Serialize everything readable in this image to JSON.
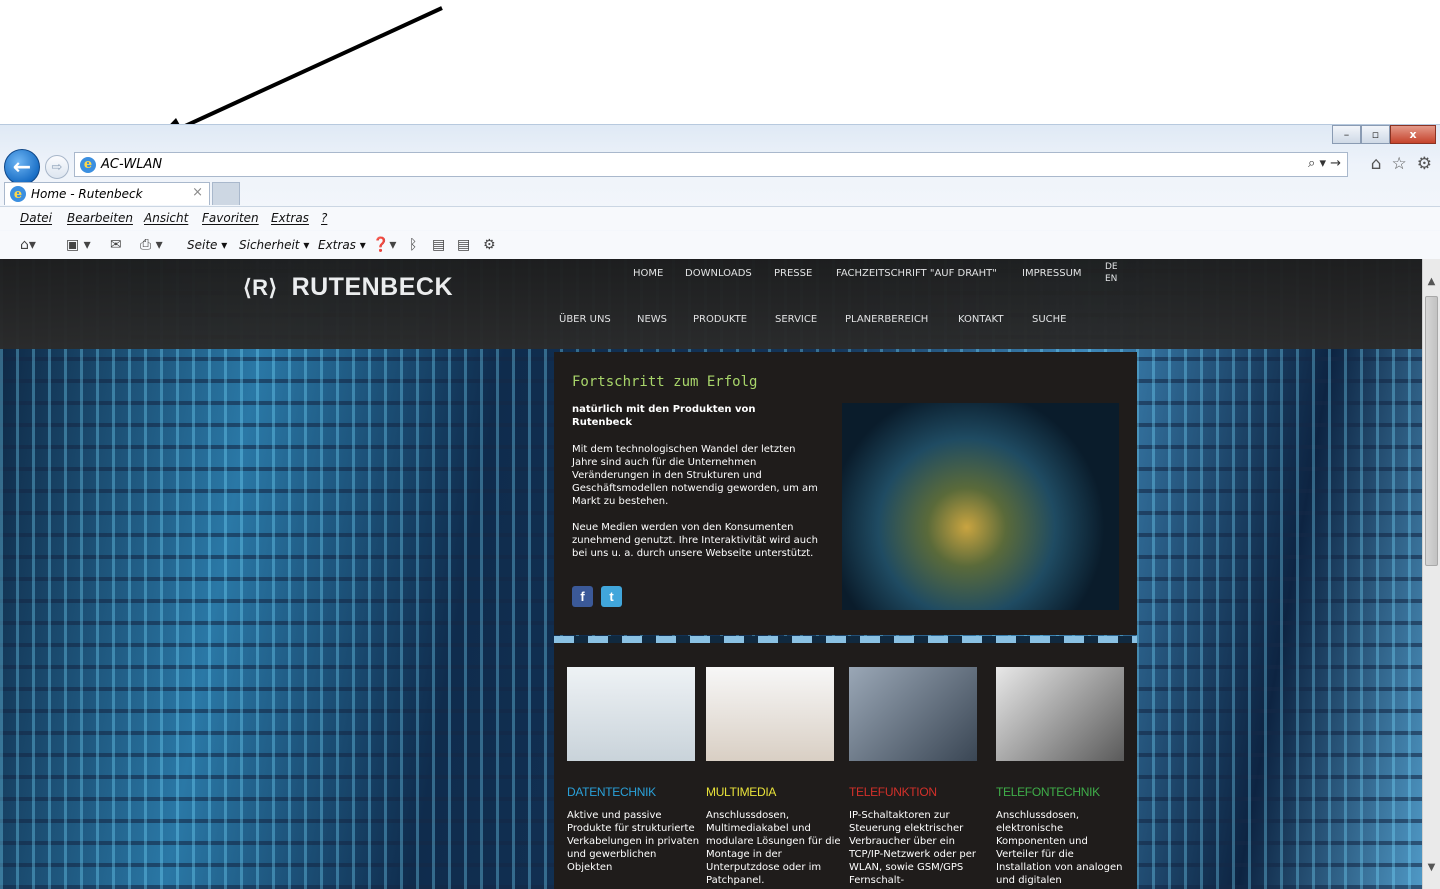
{
  "browser": {
    "address_text": "AC-WLAN",
    "tab_title": "Home - Rutenbeck",
    "tab_close": "×",
    "min_label": "–",
    "max_label": "▫",
    "close_label": "x",
    "back_icon": "arrow-left-icon",
    "forward_icon": "arrow-right-icon",
    "addr_tools": "⌕ ▾ →",
    "menu": [
      "Datei",
      "Bearbeiten",
      "Ansicht",
      "Favoriten",
      "Extras",
      "?"
    ],
    "commands": [
      "Seite ▾",
      "Sicherheit ▾",
      "Extras ▾"
    ]
  },
  "site": {
    "logo_mark": "⟨R⟩",
    "logo_text": "RUTENBECK",
    "top_nav": [
      "HOME",
      "DOWNLOADS",
      "PRESSE",
      "FACHZEITSCHRIFT \"AUF DRAHT\"",
      "IMPRESSUM"
    ],
    "langs": [
      "DE",
      "EN"
    ],
    "main_nav": [
      "ÜBER UNS",
      "NEWS",
      "PRODUKTE",
      "SERVICE",
      "PLANERBEREICH",
      "KONTAKT",
      "SUCHE"
    ],
    "intro": {
      "title": "Fortschritt zum Erfolg",
      "subtitle": "natürlich mit den Produkten von Rutenbeck",
      "p1": "Mit dem technologischen Wandel der letzten Jahre sind auch für die Unternehmen Veränderungen in den Strukturen und Geschäftsmodellen notwendig geworden, um am Markt zu bestehen.",
      "p2": "Neue Medien werden von den Konsumenten zunehmend genutzt. Ihre Interaktivität wird auch bei uns u. a. durch unsere Webseite unterstützt.",
      "facebook": "f",
      "twitter": "t"
    },
    "products": [
      {
        "name": "DATENTECHNIK",
        "color": "#2aa0d8",
        "desc": "Aktive und passive Produkte für strukturierte Verkabelungen in privaten und gewerblichen Objekten"
      },
      {
        "name": "MULTIMEDIA",
        "color": "#e8e23a",
        "desc": "Anschlussdosen, Multimediakabel und modulare Lösungen für die Montage in der Unterputzdose oder im Patchpanel."
      },
      {
        "name": "TELEFUNKTION",
        "color": "#d2302a",
        "desc": "IP-Schaltaktoren zur Steuerung elektrischer Verbraucher über ein TCP/IP-Netzwerk oder per WLAN, sowie GSM/GPS Fernschalt-"
      },
      {
        "name": "TELEFONTECHNIK",
        "color": "#3fae49",
        "desc": "Anschlussdosen, elektronische Komponenten und Verteiler für die Installation von analogen und digitalen"
      }
    ]
  }
}
